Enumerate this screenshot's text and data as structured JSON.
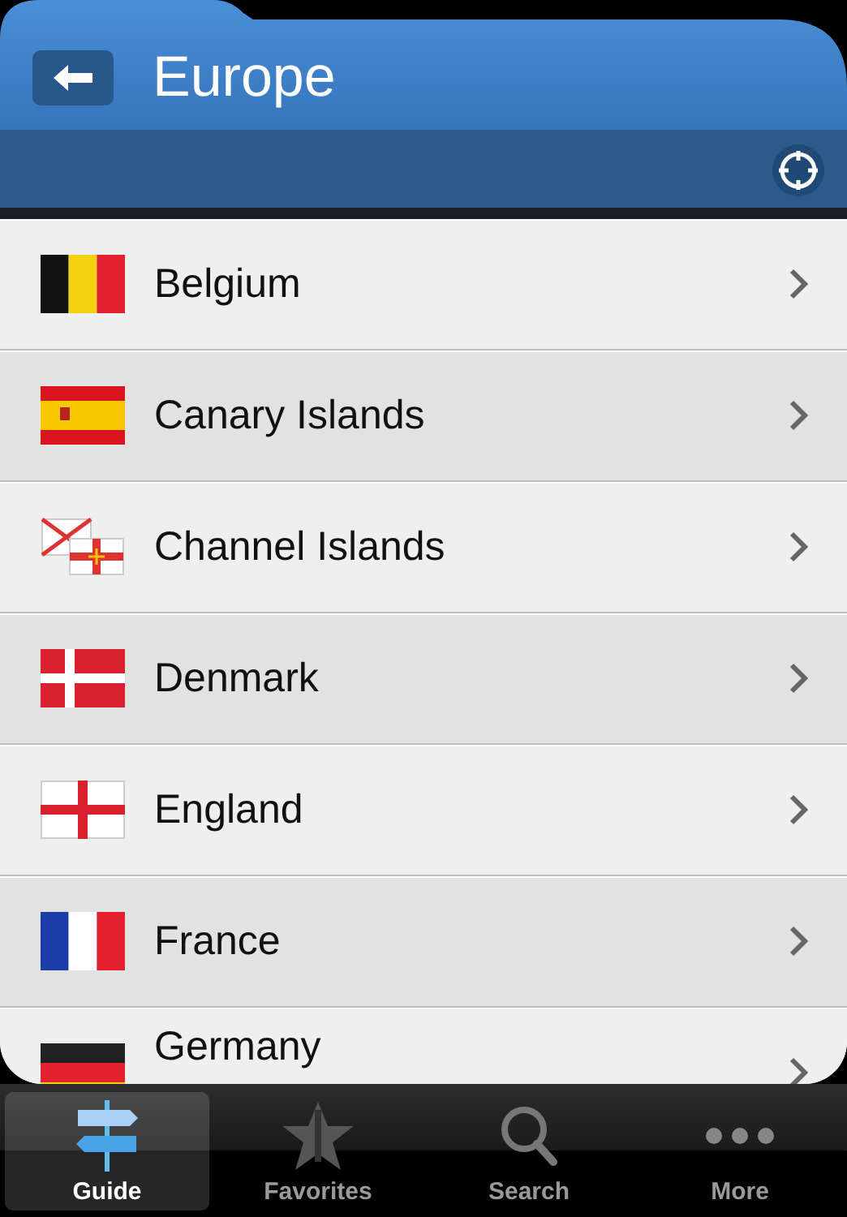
{
  "header": {
    "title": "Europe"
  },
  "countries": [
    {
      "name": "Belgium",
      "kind": "belgium"
    },
    {
      "name": "Canary Islands",
      "kind": "spain"
    },
    {
      "name": "Channel Islands",
      "kind": "channel"
    },
    {
      "name": "Denmark",
      "kind": "denmark"
    },
    {
      "name": "England",
      "kind": "england"
    },
    {
      "name": "France",
      "kind": "france"
    },
    {
      "name": "Germany",
      "kind": "germany"
    }
  ],
  "tabs": [
    {
      "label": "Guide",
      "kind": "guide",
      "selected": true
    },
    {
      "label": "Favorites",
      "kind": "favorites",
      "selected": false
    },
    {
      "label": "Search",
      "kind": "search",
      "selected": false
    },
    {
      "label": "More",
      "kind": "more",
      "selected": false
    }
  ]
}
